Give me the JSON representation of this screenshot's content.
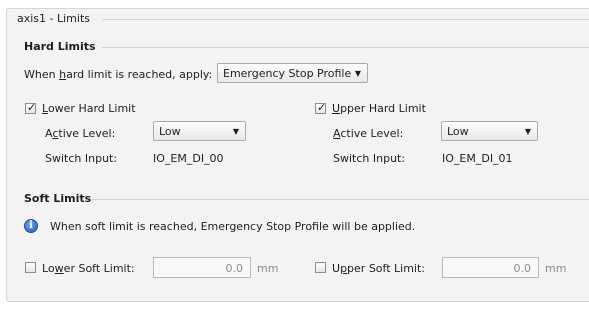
{
  "panel": {
    "title": "axis1 - Limits"
  },
  "hard_limits": {
    "section_title": "Hard Limits",
    "apply_label_pre": "When ",
    "apply_label_mnemonic": "h",
    "apply_label_post": "ard limit is reached, apply:",
    "apply_value": "Emergency Stop Profile",
    "lower": {
      "checkbox_mnemonic": "L",
      "checkbox_label_rest": "ower Hard Limit",
      "checked": true,
      "active_level_pre": "A",
      "active_level_mnemonic": "c",
      "active_level_post": "tive Level:",
      "active_level_value": "Low",
      "switch_label": "Switch Input:",
      "switch_value": "IO_EM_DI_00"
    },
    "upper": {
      "checkbox_mnemonic": "U",
      "checkbox_label_rest": "pper Hard Limit",
      "checked": true,
      "active_level_mnemonic": "A",
      "active_level_post": "ctive Level:",
      "active_level_value": "Low",
      "switch_label": "Switch Input:",
      "switch_value": "IO_EM_DI_01"
    }
  },
  "soft_limits": {
    "section_title": "Soft Limits",
    "info_text": "When soft limit is reached, Emergency Stop Profile will be applied.",
    "lower": {
      "label_pre": "Lo",
      "label_mnemonic": "w",
      "label_post": "er Soft Limit:",
      "checked": false,
      "value": "0.0",
      "unit": "mm"
    },
    "upper": {
      "label_pre": "U",
      "label_mnemonic": "p",
      "label_post": "per Soft Limit:",
      "checked": false,
      "value": "0.0",
      "unit": "mm"
    }
  },
  "icons": {
    "info": "info-icon",
    "dropdown": "chevron-down-icon",
    "check": "checkmark-icon"
  }
}
